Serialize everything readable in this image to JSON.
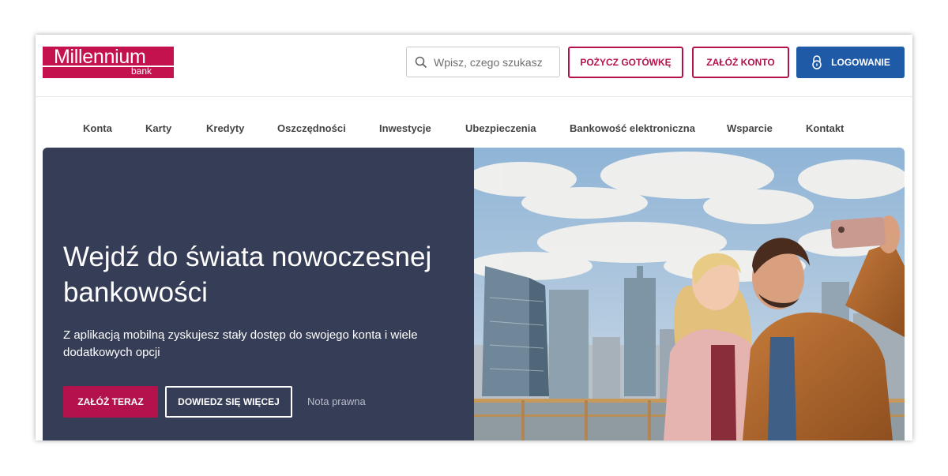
{
  "header": {
    "logo_name": "Millennium",
    "logo_sub": "bank",
    "search_placeholder": "Wpisz, czego szukasz",
    "loan_button": "POŻYCZ GOTÓWKĘ",
    "open_account_button": "ZAŁÓŻ KONTO",
    "login_button": "LOGOWANIE"
  },
  "nav": {
    "items": [
      "Konta",
      "Karty",
      "Kredyty",
      "Oszczędności",
      "Inwestycje",
      "Ubezpieczenia",
      "Bankowość elektroniczna",
      "Wsparcie",
      "Kontakt"
    ]
  },
  "hero": {
    "title_line1": "Wejdź do świata nowoczesnej",
    "title_line2": "bankowości",
    "subtitle": "Z aplikacją mobilną zyskujesz stały dostęp do swojego konta i wiele dodatkowych opcji",
    "primary_button": "ZAŁÓŻ TERAZ",
    "secondary_button": "DOWIEDZ SIĘ WIĘCEJ",
    "legal_link": "Nota prawna"
  },
  "colors": {
    "brand": "#c4124f",
    "login": "#1f5aa6",
    "hero_bg": "#363d56"
  },
  "icons": {
    "search": "search-icon",
    "login": "padlock-icon"
  }
}
